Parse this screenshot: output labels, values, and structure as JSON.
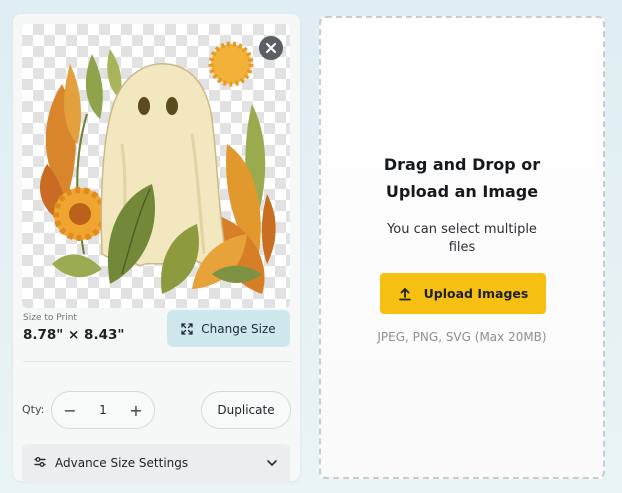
{
  "product_card": {
    "size_label": "Size to Print",
    "size_value": "8.78\" × 8.43\"",
    "change_size_label": "Change Size",
    "qty_label": "Qty:",
    "qty_value": "1",
    "minus_symbol": "−",
    "plus_symbol": "+",
    "duplicate_label": "Duplicate",
    "advance_label": "Advance Size Settings",
    "icons": {
      "close": "close-icon",
      "resize": "resize-icon",
      "settings": "sliders-icon",
      "chevron": "chevron-down-icon"
    }
  },
  "upload": {
    "title_line1": "Drag and Drop or",
    "title_line2": "Upload an Image",
    "subtitle_line1": "You can select multiple",
    "subtitle_line2": "files",
    "button_label": "Upload Images",
    "formats": "JPEG, PNG, SVG (Max 20MB)",
    "icon": "upload-icon"
  },
  "colors": {
    "upload_button": "#f6c012",
    "change_size_button": "#cfe8ee",
    "background": "#e3eff3"
  }
}
